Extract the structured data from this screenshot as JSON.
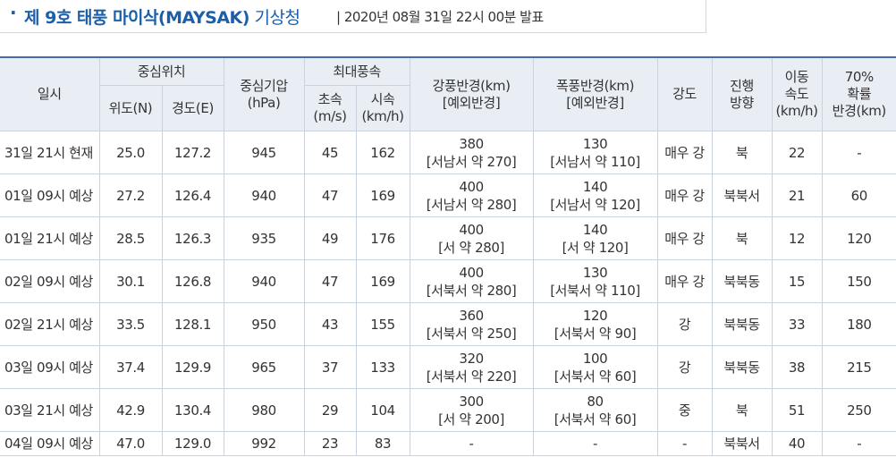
{
  "header": {
    "bullet": "·",
    "title": "제 9호 태풍 마이삭(MAYSAK)",
    "title_suffix": " 기상청",
    "issued": "| 2020년 08월 31일 22시 00분 발표"
  },
  "table": {
    "col_date": "일시",
    "grp_center": "중심위치",
    "col_lat": "위도(N)",
    "col_lon": "경도(E)",
    "col_pressure_1": "중심기압",
    "col_pressure_2": "(hPa)",
    "grp_wind": "최대풍속",
    "col_wind_ms_1": "초속",
    "col_wind_ms_2": "(m/s)",
    "col_wind_kmh_1": "시속",
    "col_wind_kmh_2": "(km/h)",
    "col_strong_1": "강풍반경(km)",
    "col_strong_2": "[예외반경]",
    "col_storm_1": "폭풍반경(km)",
    "col_storm_2": "[예외반경]",
    "col_intensity": "강도",
    "col_dir_1": "진행",
    "col_dir_2": "방향",
    "col_speed_1": "이동",
    "col_speed_2": "속도",
    "col_speed_3": "(km/h)",
    "col_prob_1": "70%",
    "col_prob_2": "확률",
    "col_prob_3": "반경(km)",
    "rows": [
      {
        "date": "31일 21시 현재",
        "lat": "25.0",
        "lon": "127.2",
        "pressure": "945",
        "ms": "45",
        "kmh": "162",
        "strong": "380",
        "strong_ex": "[서남서 약 270]",
        "storm": "130",
        "storm_ex": "[서남서 약 110]",
        "intensity": "매우 강",
        "dir": "북",
        "speed": "22",
        "prob": "-"
      },
      {
        "date": "01일 09시 예상",
        "lat": "27.2",
        "lon": "126.4",
        "pressure": "940",
        "ms": "47",
        "kmh": "169",
        "strong": "400",
        "strong_ex": "[서남서 약 280]",
        "storm": "140",
        "storm_ex": "[서남서 약 120]",
        "intensity": "매우 강",
        "dir": "북북서",
        "speed": "21",
        "prob": "60"
      },
      {
        "date": "01일 21시 예상",
        "lat": "28.5",
        "lon": "126.3",
        "pressure": "935",
        "ms": "49",
        "kmh": "176",
        "strong": "400",
        "strong_ex": "[서 약 280]",
        "storm": "140",
        "storm_ex": "[서 약 120]",
        "intensity": "매우 강",
        "dir": "북",
        "speed": "12",
        "prob": "120"
      },
      {
        "date": "02일 09시 예상",
        "lat": "30.1",
        "lon": "126.8",
        "pressure": "940",
        "ms": "47",
        "kmh": "169",
        "strong": "400",
        "strong_ex": "[서북서 약 280]",
        "storm": "130",
        "storm_ex": "[서북서 약 110]",
        "intensity": "매우 강",
        "dir": "북북동",
        "speed": "15",
        "prob": "150"
      },
      {
        "date": "02일 21시 예상",
        "lat": "33.5",
        "lon": "128.1",
        "pressure": "950",
        "ms": "43",
        "kmh": "155",
        "strong": "360",
        "strong_ex": "[서북서 약 250]",
        "storm": "120",
        "storm_ex": "[서북서 약 90]",
        "intensity": "강",
        "dir": "북북동",
        "speed": "33",
        "prob": "180"
      },
      {
        "date": "03일 09시 예상",
        "lat": "37.4",
        "lon": "129.9",
        "pressure": "965",
        "ms": "37",
        "kmh": "133",
        "strong": "320",
        "strong_ex": "[서북서 약 220]",
        "storm": "100",
        "storm_ex": "[서북서 약 60]",
        "intensity": "강",
        "dir": "북북동",
        "speed": "38",
        "prob": "215"
      },
      {
        "date": "03일 21시 예상",
        "lat": "42.9",
        "lon": "130.4",
        "pressure": "980",
        "ms": "29",
        "kmh": "104",
        "strong": "300",
        "strong_ex": "[서 약 200]",
        "storm": "80",
        "storm_ex": "[서북서 약 60]",
        "intensity": "중",
        "dir": "북",
        "speed": "51",
        "prob": "250"
      },
      {
        "date": "04일 09시 예상",
        "lat": "47.0",
        "lon": "129.0",
        "pressure": "992",
        "ms": "23",
        "kmh": "83",
        "strong": "-",
        "strong_ex": "",
        "storm": "-",
        "storm_ex": "",
        "intensity": "-",
        "dir": "북북서",
        "speed": "40",
        "prob": "-"
      }
    ]
  }
}
